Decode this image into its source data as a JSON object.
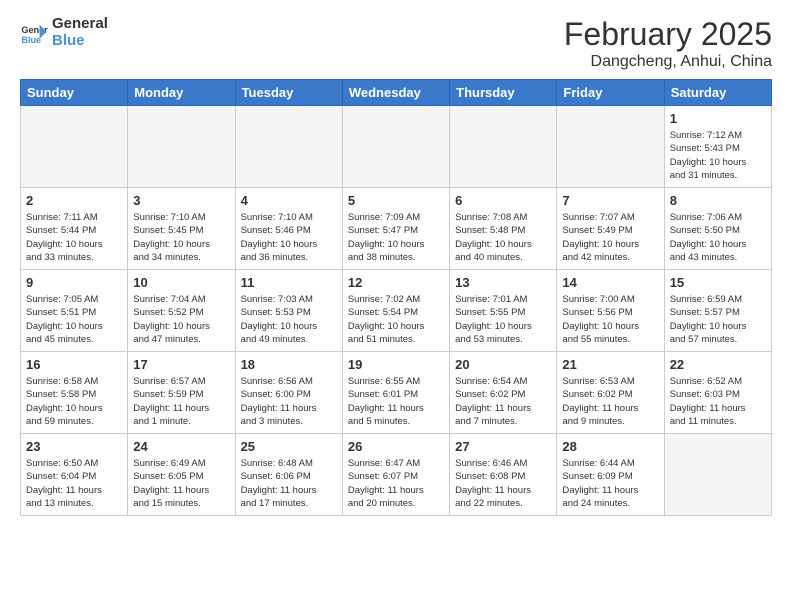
{
  "logo": {
    "line1": "General",
    "line2": "Blue"
  },
  "title": "February 2025",
  "subtitle": "Dangcheng, Anhui, China",
  "weekdays": [
    "Sunday",
    "Monday",
    "Tuesday",
    "Wednesday",
    "Thursday",
    "Friday",
    "Saturday"
  ],
  "weeks": [
    [
      {
        "day": "",
        "info": ""
      },
      {
        "day": "",
        "info": ""
      },
      {
        "day": "",
        "info": ""
      },
      {
        "day": "",
        "info": ""
      },
      {
        "day": "",
        "info": ""
      },
      {
        "day": "",
        "info": ""
      },
      {
        "day": "1",
        "info": "Sunrise: 7:12 AM\nSunset: 5:43 PM\nDaylight: 10 hours\nand 31 minutes."
      }
    ],
    [
      {
        "day": "2",
        "info": "Sunrise: 7:11 AM\nSunset: 5:44 PM\nDaylight: 10 hours\nand 33 minutes."
      },
      {
        "day": "3",
        "info": "Sunrise: 7:10 AM\nSunset: 5:45 PM\nDaylight: 10 hours\nand 34 minutes."
      },
      {
        "day": "4",
        "info": "Sunrise: 7:10 AM\nSunset: 5:46 PM\nDaylight: 10 hours\nand 36 minutes."
      },
      {
        "day": "5",
        "info": "Sunrise: 7:09 AM\nSunset: 5:47 PM\nDaylight: 10 hours\nand 38 minutes."
      },
      {
        "day": "6",
        "info": "Sunrise: 7:08 AM\nSunset: 5:48 PM\nDaylight: 10 hours\nand 40 minutes."
      },
      {
        "day": "7",
        "info": "Sunrise: 7:07 AM\nSunset: 5:49 PM\nDaylight: 10 hours\nand 42 minutes."
      },
      {
        "day": "8",
        "info": "Sunrise: 7:06 AM\nSunset: 5:50 PM\nDaylight: 10 hours\nand 43 minutes."
      }
    ],
    [
      {
        "day": "9",
        "info": "Sunrise: 7:05 AM\nSunset: 5:51 PM\nDaylight: 10 hours\nand 45 minutes."
      },
      {
        "day": "10",
        "info": "Sunrise: 7:04 AM\nSunset: 5:52 PM\nDaylight: 10 hours\nand 47 minutes."
      },
      {
        "day": "11",
        "info": "Sunrise: 7:03 AM\nSunset: 5:53 PM\nDaylight: 10 hours\nand 49 minutes."
      },
      {
        "day": "12",
        "info": "Sunrise: 7:02 AM\nSunset: 5:54 PM\nDaylight: 10 hours\nand 51 minutes."
      },
      {
        "day": "13",
        "info": "Sunrise: 7:01 AM\nSunset: 5:55 PM\nDaylight: 10 hours\nand 53 minutes."
      },
      {
        "day": "14",
        "info": "Sunrise: 7:00 AM\nSunset: 5:56 PM\nDaylight: 10 hours\nand 55 minutes."
      },
      {
        "day": "15",
        "info": "Sunrise: 6:59 AM\nSunset: 5:57 PM\nDaylight: 10 hours\nand 57 minutes."
      }
    ],
    [
      {
        "day": "16",
        "info": "Sunrise: 6:58 AM\nSunset: 5:58 PM\nDaylight: 10 hours\nand 59 minutes."
      },
      {
        "day": "17",
        "info": "Sunrise: 6:57 AM\nSunset: 5:59 PM\nDaylight: 11 hours\nand 1 minute."
      },
      {
        "day": "18",
        "info": "Sunrise: 6:56 AM\nSunset: 6:00 PM\nDaylight: 11 hours\nand 3 minutes."
      },
      {
        "day": "19",
        "info": "Sunrise: 6:55 AM\nSunset: 6:01 PM\nDaylight: 11 hours\nand 5 minutes."
      },
      {
        "day": "20",
        "info": "Sunrise: 6:54 AM\nSunset: 6:02 PM\nDaylight: 11 hours\nand 7 minutes."
      },
      {
        "day": "21",
        "info": "Sunrise: 6:53 AM\nSunset: 6:02 PM\nDaylight: 11 hours\nand 9 minutes."
      },
      {
        "day": "22",
        "info": "Sunrise: 6:52 AM\nSunset: 6:03 PM\nDaylight: 11 hours\nand 11 minutes."
      }
    ],
    [
      {
        "day": "23",
        "info": "Sunrise: 6:50 AM\nSunset: 6:04 PM\nDaylight: 11 hours\nand 13 minutes."
      },
      {
        "day": "24",
        "info": "Sunrise: 6:49 AM\nSunset: 6:05 PM\nDaylight: 11 hours\nand 15 minutes."
      },
      {
        "day": "25",
        "info": "Sunrise: 6:48 AM\nSunset: 6:06 PM\nDaylight: 11 hours\nand 17 minutes."
      },
      {
        "day": "26",
        "info": "Sunrise: 6:47 AM\nSunset: 6:07 PM\nDaylight: 11 hours\nand 20 minutes."
      },
      {
        "day": "27",
        "info": "Sunrise: 6:46 AM\nSunset: 6:08 PM\nDaylight: 11 hours\nand 22 minutes."
      },
      {
        "day": "28",
        "info": "Sunrise: 6:44 AM\nSunset: 6:09 PM\nDaylight: 11 hours\nand 24 minutes."
      },
      {
        "day": "",
        "info": ""
      }
    ]
  ]
}
